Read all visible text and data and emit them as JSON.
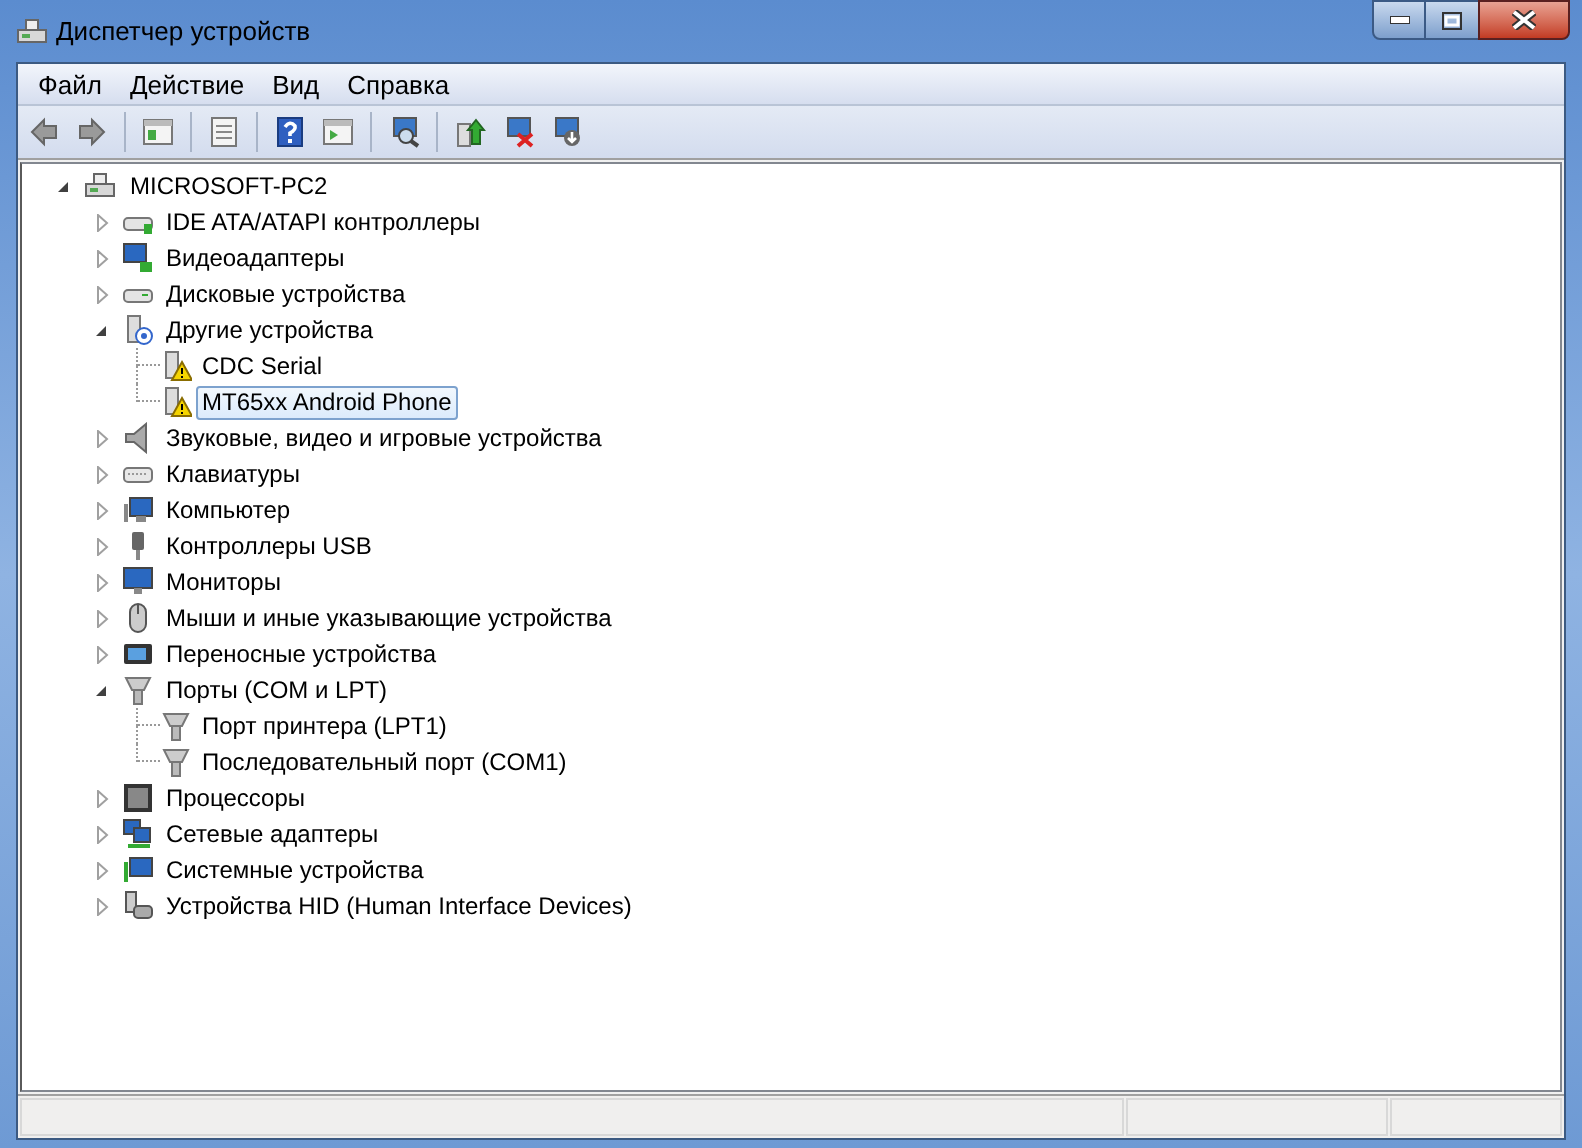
{
  "window": {
    "title": "Диспетчер устройств"
  },
  "menu": [
    "Файл",
    "Действие",
    "Вид",
    "Справка"
  ],
  "tree": {
    "label": "MICROSOFT-PC2",
    "expanded": true,
    "selected": false,
    "children": [
      {
        "label": "IDE ATA/ATAPI контроллеры",
        "expanded": false,
        "selected": false
      },
      {
        "label": "Видеоадаптеры",
        "expanded": false,
        "selected": false
      },
      {
        "label": "Дисковые устройства",
        "expanded": false,
        "selected": false
      },
      {
        "label": "Другие устройства",
        "expanded": true,
        "selected": false,
        "children": [
          {
            "label": "CDC Serial",
            "selected": false
          },
          {
            "label": "MT65xx Android Phone",
            "selected": true
          }
        ]
      },
      {
        "label": "Звуковые, видео и игровые устройства",
        "expanded": false,
        "selected": false
      },
      {
        "label": "Клавиатуры",
        "expanded": false,
        "selected": false
      },
      {
        "label": "Компьютер",
        "expanded": false,
        "selected": false
      },
      {
        "label": "Контроллеры USB",
        "expanded": false,
        "selected": false
      },
      {
        "label": "Мониторы",
        "expanded": false,
        "selected": false
      },
      {
        "label": "Мыши и иные указывающие устройства",
        "expanded": false,
        "selected": false
      },
      {
        "label": "Переносные устройства",
        "expanded": false,
        "selected": false
      },
      {
        "label": "Порты (COM и LPT)",
        "expanded": true,
        "selected": false,
        "children": [
          {
            "label": "Порт принтера (LPT1)",
            "selected": false
          },
          {
            "label": "Последовательный порт (COM1)",
            "selected": false
          }
        ]
      },
      {
        "label": "Процессоры",
        "expanded": false,
        "selected": false
      },
      {
        "label": "Сетевые адаптеры",
        "expanded": false,
        "selected": false
      },
      {
        "label": "Системные устройства",
        "expanded": false,
        "selected": false
      },
      {
        "label": "Устройства HID (Human Interface Devices)",
        "expanded": false,
        "selected": false
      }
    ]
  }
}
